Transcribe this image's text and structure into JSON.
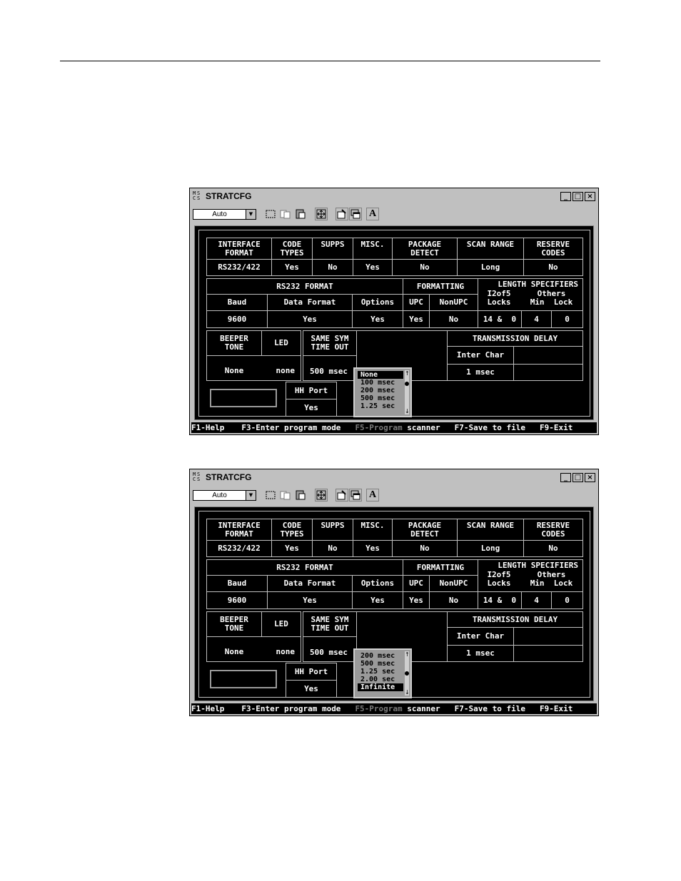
{
  "window": {
    "title": "STRATCFG",
    "icon_letters": [
      "M",
      "S",
      "C",
      "S"
    ],
    "controls": [
      "_",
      "□",
      "×"
    ]
  },
  "toolbar": {
    "combo_value": "Auto",
    "font_button": "A"
  },
  "table": {
    "row1_headers": [
      "INTERFACE\nFORMAT",
      "CODE\nTYPES",
      "SUPPS",
      "MISC.",
      "PACKAGE\nDETECT",
      "SCAN RANGE",
      "RESERVE\nCODES"
    ],
    "row1_values": [
      "RS232/422",
      "Yes",
      "No",
      "Yes",
      "No",
      "Long",
      "No"
    ],
    "rs232_title": "RS232 FORMAT",
    "rs232_headers": [
      "Baud",
      "Data Format",
      "Options"
    ],
    "rs232_values": [
      "9600",
      "Yes",
      "Yes"
    ],
    "formatting_title": "FORMATTING",
    "formatting_headers": [
      "UPC",
      "NonUPC"
    ],
    "formatting_values": [
      "Yes",
      "No"
    ],
    "length_title": "LENGTH SPECIFIERS",
    "length_headers": [
      "I2of5\nLocks",
      "Others\nMin  Lock"
    ],
    "length_values": [
      "14 &  0",
      "4",
      "0"
    ],
    "beeper_header": "BEEPER\nTONE",
    "led_header": "LED",
    "beeper_value": "None",
    "led_value": "none",
    "same_sym_header": "SAME SYM\nTIME OUT",
    "same_sym_value": "500 msec",
    "transmission_title": "TRANSMISSION DELAY",
    "inter_char_label": "Inter Char",
    "inter_char_value": "1 msec",
    "hh_port_label": "HH Port",
    "hh_port_value": "Yes"
  },
  "status_bar": {
    "f1": "F1-Help",
    "f3": "F3-Enter program mode",
    "f5a": "F5-Program",
    "f5b": " scanner",
    "f7": "F7-Save to file",
    "f9": "F9-Exit"
  },
  "screens": [
    {
      "dropdown_items": [
        "None",
        "100 msec",
        "200 msec",
        "500 msec",
        "1.25 sec"
      ],
      "selected_index": 0
    },
    {
      "dropdown_items": [
        "200 msec",
        "500 msec",
        "1.25 sec",
        "2.00 sec",
        "Infinite"
      ],
      "selected_index": 4
    }
  ]
}
